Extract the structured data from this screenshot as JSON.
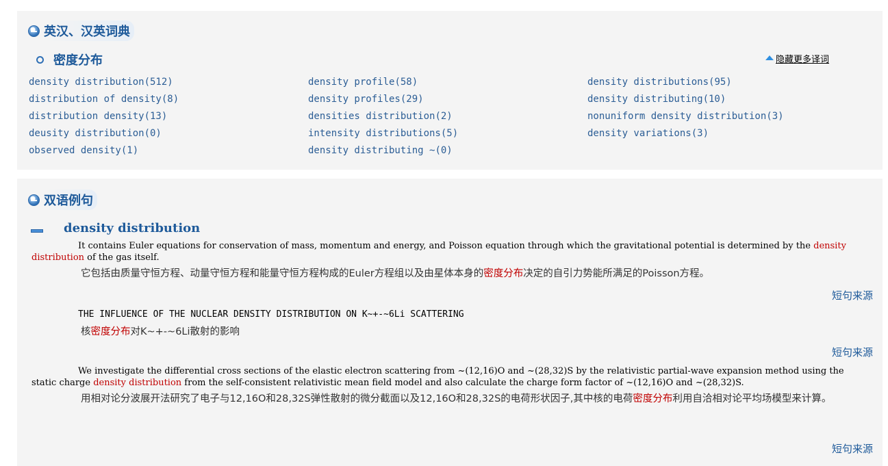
{
  "dict": {
    "section_title": "英汉、汉英词典",
    "term_title": "密度分布",
    "hide_more": "隐藏更多译词",
    "terms": [
      [
        "density distribution",
        "(512)"
      ],
      [
        "density profile",
        "(58)"
      ],
      [
        "density distributions",
        "(95)"
      ],
      [
        "distribution of density",
        "(8)"
      ],
      [
        "density profiles",
        "(29)"
      ],
      [
        "density distributing",
        "(10)"
      ],
      [
        "distribution density",
        "(13)"
      ],
      [
        "densities distribution",
        "(2)"
      ],
      [
        "nonuniform density distribution",
        "(3)"
      ],
      [
        "deusity distribution",
        "(0)"
      ],
      [
        "intensity distributions",
        "(5)"
      ],
      [
        "density variations",
        "(3)"
      ],
      [
        "observed density",
        "(1)"
      ],
      [
        "density distributing ~",
        "(0)"
      ]
    ]
  },
  "examples": {
    "section_title": "双语例句",
    "term": "density distribution",
    "source_label": "短句来源",
    "items": [
      {
        "en_before": "It contains Euler equations for conservation of mass, momentum and energy, and Poisson equation through which the gravitational potential is determined by the ",
        "en_hl": "density distribution",
        "en_after": " of the gas itself.",
        "cn_before": "它包括由质量守恒方程、动量守恒方程和能量守恒方程构成的Euler方程组以及由星体本身的",
        "cn_hl": "密度分布",
        "cn_after": "决定的自引力势能所满足的Poisson方程。"
      },
      {
        "en_before": "THE INFLUENCE OF THE NUCLEAR DENSITY DISTRIBUTION ON K~+-~6Li SCATTERING",
        "en_hl": "",
        "en_after": "",
        "cn_before": "核",
        "cn_hl": "密度分布",
        "cn_after": "对K~+-~6Li散射的影响"
      },
      {
        "en_before": "We investigate the differential cross sections of the elastic electron scattering from ~(12,16)O and ~(28,32)S by the relativistic partial-wave expansion method using the static charge ",
        "en_hl": "density distribution",
        "en_after": " from the self-consistent relativistic mean field model and also calculate the charge form factor of ~(12,16)O and ~(28,32)S.",
        "cn_before": "用相对论分波展开法研究了电子与12,16O和28,32S弹性散射的微分截面以及12,16O和28,32S的电荷形状因子,其中核的电荷",
        "cn_hl": "密度分布",
        "cn_after": "利用自洽相对论平均场模型来计算。"
      }
    ]
  },
  "colors": {
    "link": "#2b5d95",
    "highlight": "#c00000",
    "panel_bg": "#f4f4f4"
  },
  "icons": [
    "section-bullet-icon",
    "ring-bullet-icon",
    "up-arrow-icon",
    "collapse-minus-icon"
  ]
}
